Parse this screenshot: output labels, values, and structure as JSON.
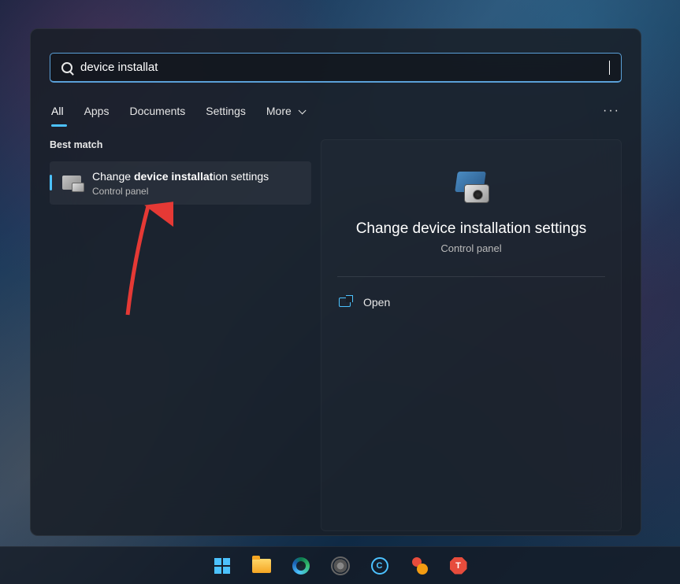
{
  "search": {
    "query": "device installat"
  },
  "tabs": {
    "all": "All",
    "apps": "Apps",
    "documents": "Documents",
    "settings": "Settings",
    "more": "More"
  },
  "section": {
    "best_match": "Best match"
  },
  "result": {
    "title_pre": "Change ",
    "title_bold": "device installat",
    "title_post": "ion settings",
    "subtitle": "Control panel"
  },
  "preview": {
    "title": "Change device installation settings",
    "subtitle": "Control panel"
  },
  "actions": {
    "open": "Open"
  },
  "taskbar": {
    "cortana_letter": "C",
    "stop_letter": "T"
  }
}
